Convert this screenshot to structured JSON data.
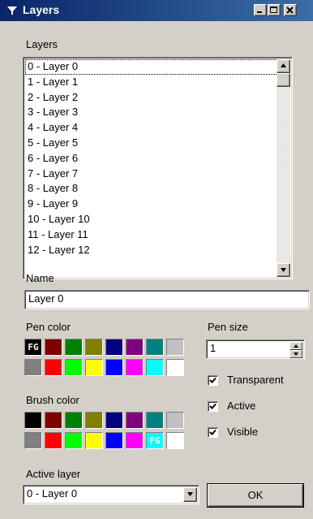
{
  "window": {
    "title": "Layers",
    "icon": "funnel-icon",
    "controls": [
      "minimize-icon",
      "maximize-icon",
      "close-icon"
    ]
  },
  "layers": {
    "label": "Layers",
    "items": [
      "0 - Layer 0",
      "1 - Layer 1",
      "2 - Layer 2",
      "3 - Layer 3",
      "4 - Layer 4",
      "5 - Layer 5",
      "6 - Layer 6",
      "7 - Layer 7",
      "8 - Layer 8",
      "9 - Layer 9",
      "10 - Layer 10",
      "11 - Layer 11",
      "12 - Layer 12"
    ],
    "focused_index": 0
  },
  "name": {
    "label": "Name",
    "value": "Layer 0"
  },
  "pen_color": {
    "label": "Pen color",
    "marker": "FG",
    "marker_index": 0,
    "swatches": [
      "#000000",
      "#800000",
      "#008000",
      "#808000",
      "#000080",
      "#800080",
      "#008080",
      "#c0c0c0",
      "#808080",
      "#ff0000",
      "#00ff00",
      "#ffff00",
      "#0000ff",
      "#ff00ff",
      "#00ffff",
      "#ffffff"
    ]
  },
  "brush_color": {
    "label": "Brush color",
    "marker": "FG",
    "marker_index": 14,
    "swatches": [
      "#000000",
      "#800000",
      "#008000",
      "#808000",
      "#000080",
      "#800080",
      "#008080",
      "#c0c0c0",
      "#808080",
      "#ff0000",
      "#00ff00",
      "#ffff00",
      "#0000ff",
      "#ff00ff",
      "#00ffff",
      "#ffffff"
    ]
  },
  "pen_size": {
    "label": "Pen size",
    "value": "1"
  },
  "checkboxes": {
    "transparent": {
      "label": "Transparent",
      "checked": true
    },
    "active": {
      "label": "Active",
      "checked": true
    },
    "visible": {
      "label": "Visible",
      "checked": true
    }
  },
  "active_layer": {
    "label": "Active layer",
    "value": "0 - Layer 0"
  },
  "ok_button": {
    "label": "OK"
  }
}
